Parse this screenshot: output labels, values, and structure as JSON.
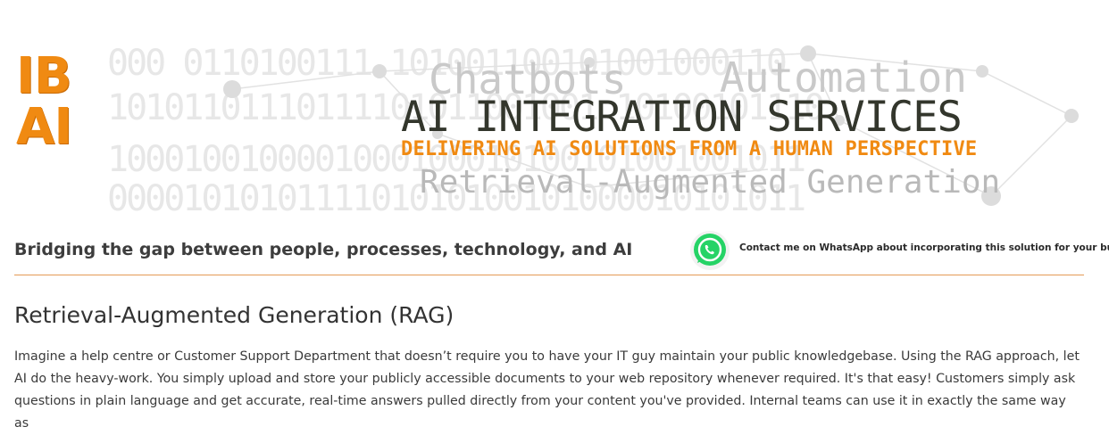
{
  "logo": {
    "line1": "IB",
    "line2": "AI"
  },
  "banner": {
    "background_binary": [
      "000 0110100111  101001100101001000110",
      "10101101110111101011001001  10100101110",
      "1000100100001000100010100101001001011",
      "0000101010111101010100101000010101011"
    ],
    "tag_left": "Chatbots",
    "tag_right": "Automation",
    "headline": "AI INTEGRATION SERVICES",
    "subhead": "DELIVERING AI SOLUTIONS FROM A HUMAN PERSPECTIVE",
    "tag_bottom": "Retrieval-Augmented Generation"
  },
  "header": {
    "tagline": "Bridging the gap between people, processes, technology, and AI",
    "whatsapp_label": "Contact me on WhatsApp about incorporating this solution for your business"
  },
  "colors": {
    "accent_orange": "#f08a12",
    "whatsapp_green": "#25d366",
    "divider": "#e49a55"
  },
  "content": {
    "title": "Retrieval-Augmented Generation (RAG)",
    "paragraph": "Imagine a help centre or Customer Support Department that doesn’t require you to have your IT guy maintain your public knowledgebase. Using the RAG approach, let AI do the heavy-work. You simply upload and store your publicly accessible documents to your web repository whenever required. It's that easy! Customers simply ask questions in plain language and get accurate, real-time answers pulled directly from your content you've provided. Internal teams can use it in exactly the same way as"
  }
}
